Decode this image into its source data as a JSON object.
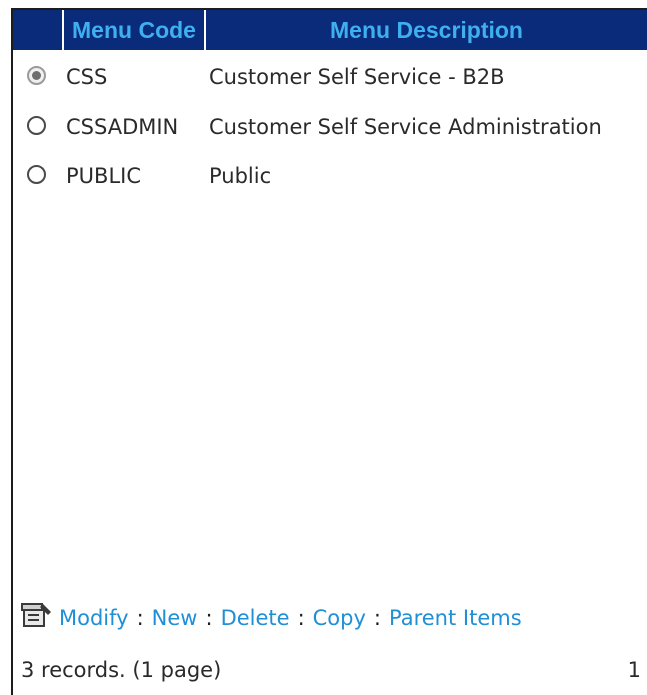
{
  "table": {
    "headers": {
      "select": "",
      "code": "Menu Code",
      "description": "Menu Description"
    },
    "rows": [
      {
        "code": "CSS",
        "description": "Customer Self Service - B2B",
        "selected": true
      },
      {
        "code": "CSSADMIN",
        "description": "Customer Self Service Administration",
        "selected": false
      },
      {
        "code": "PUBLIC",
        "description": "Public",
        "selected": false
      }
    ]
  },
  "actions": {
    "icon": "properties-icon",
    "modify": "Modify",
    "new": "New",
    "delete": "Delete",
    "copy": "Copy",
    "parent_items": "Parent Items",
    "separator": ":"
  },
  "footer": {
    "records": "3 records. (1 page)",
    "page": "1"
  },
  "colors": {
    "header_bg": "#0a2a7a",
    "header_text": "#3fb0ef",
    "link": "#1f8fd6"
  }
}
